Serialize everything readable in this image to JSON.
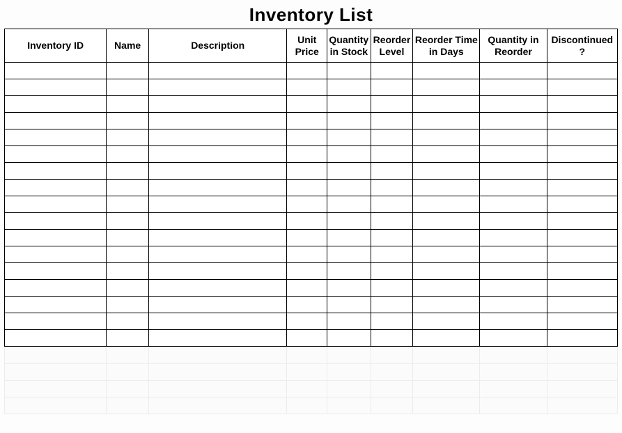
{
  "title": "Inventory List",
  "columns": [
    "Inventory ID",
    "Name",
    "Description",
    "Unit Price",
    "Quantity in Stock",
    "Reorder Level",
    "Reorder Time in Days",
    "Quantity in Reorder",
    "Discontinued?"
  ],
  "rows": [
    [
      "",
      "",
      "",
      "",
      "",
      "",
      "",
      "",
      ""
    ],
    [
      "",
      "",
      "",
      "",
      "",
      "",
      "",
      "",
      ""
    ],
    [
      "",
      "",
      "",
      "",
      "",
      "",
      "",
      "",
      ""
    ],
    [
      "",
      "",
      "",
      "",
      "",
      "",
      "",
      "",
      ""
    ],
    [
      "",
      "",
      "",
      "",
      "",
      "",
      "",
      "",
      ""
    ],
    [
      "",
      "",
      "",
      "",
      "",
      "",
      "",
      "",
      ""
    ],
    [
      "",
      "",
      "",
      "",
      "",
      "",
      "",
      "",
      ""
    ],
    [
      "",
      "",
      "",
      "",
      "",
      "",
      "",
      "",
      ""
    ],
    [
      "",
      "",
      "",
      "",
      "",
      "",
      "",
      "",
      ""
    ],
    [
      "",
      "",
      "",
      "",
      "",
      "",
      "",
      "",
      ""
    ],
    [
      "",
      "",
      "",
      "",
      "",
      "",
      "",
      "",
      ""
    ],
    [
      "",
      "",
      "",
      "",
      "",
      "",
      "",
      "",
      ""
    ],
    [
      "",
      "",
      "",
      "",
      "",
      "",
      "",
      "",
      ""
    ],
    [
      "",
      "",
      "",
      "",
      "",
      "",
      "",
      "",
      ""
    ],
    [
      "",
      "",
      "",
      "",
      "",
      "",
      "",
      "",
      ""
    ],
    [
      "",
      "",
      "",
      "",
      "",
      "",
      "",
      "",
      ""
    ],
    [
      "",
      "",
      "",
      "",
      "",
      "",
      "",
      "",
      ""
    ]
  ],
  "faint_rows": [
    [
      "",
      "",
      "",
      "",
      "",
      "",
      "",
      "",
      ""
    ],
    [
      "",
      "",
      "",
      "",
      "",
      "",
      "",
      "",
      ""
    ],
    [
      "",
      "",
      "",
      "",
      "",
      "",
      "",
      "",
      ""
    ],
    [
      "",
      "",
      "",
      "",
      "",
      "",
      "",
      "",
      ""
    ]
  ]
}
